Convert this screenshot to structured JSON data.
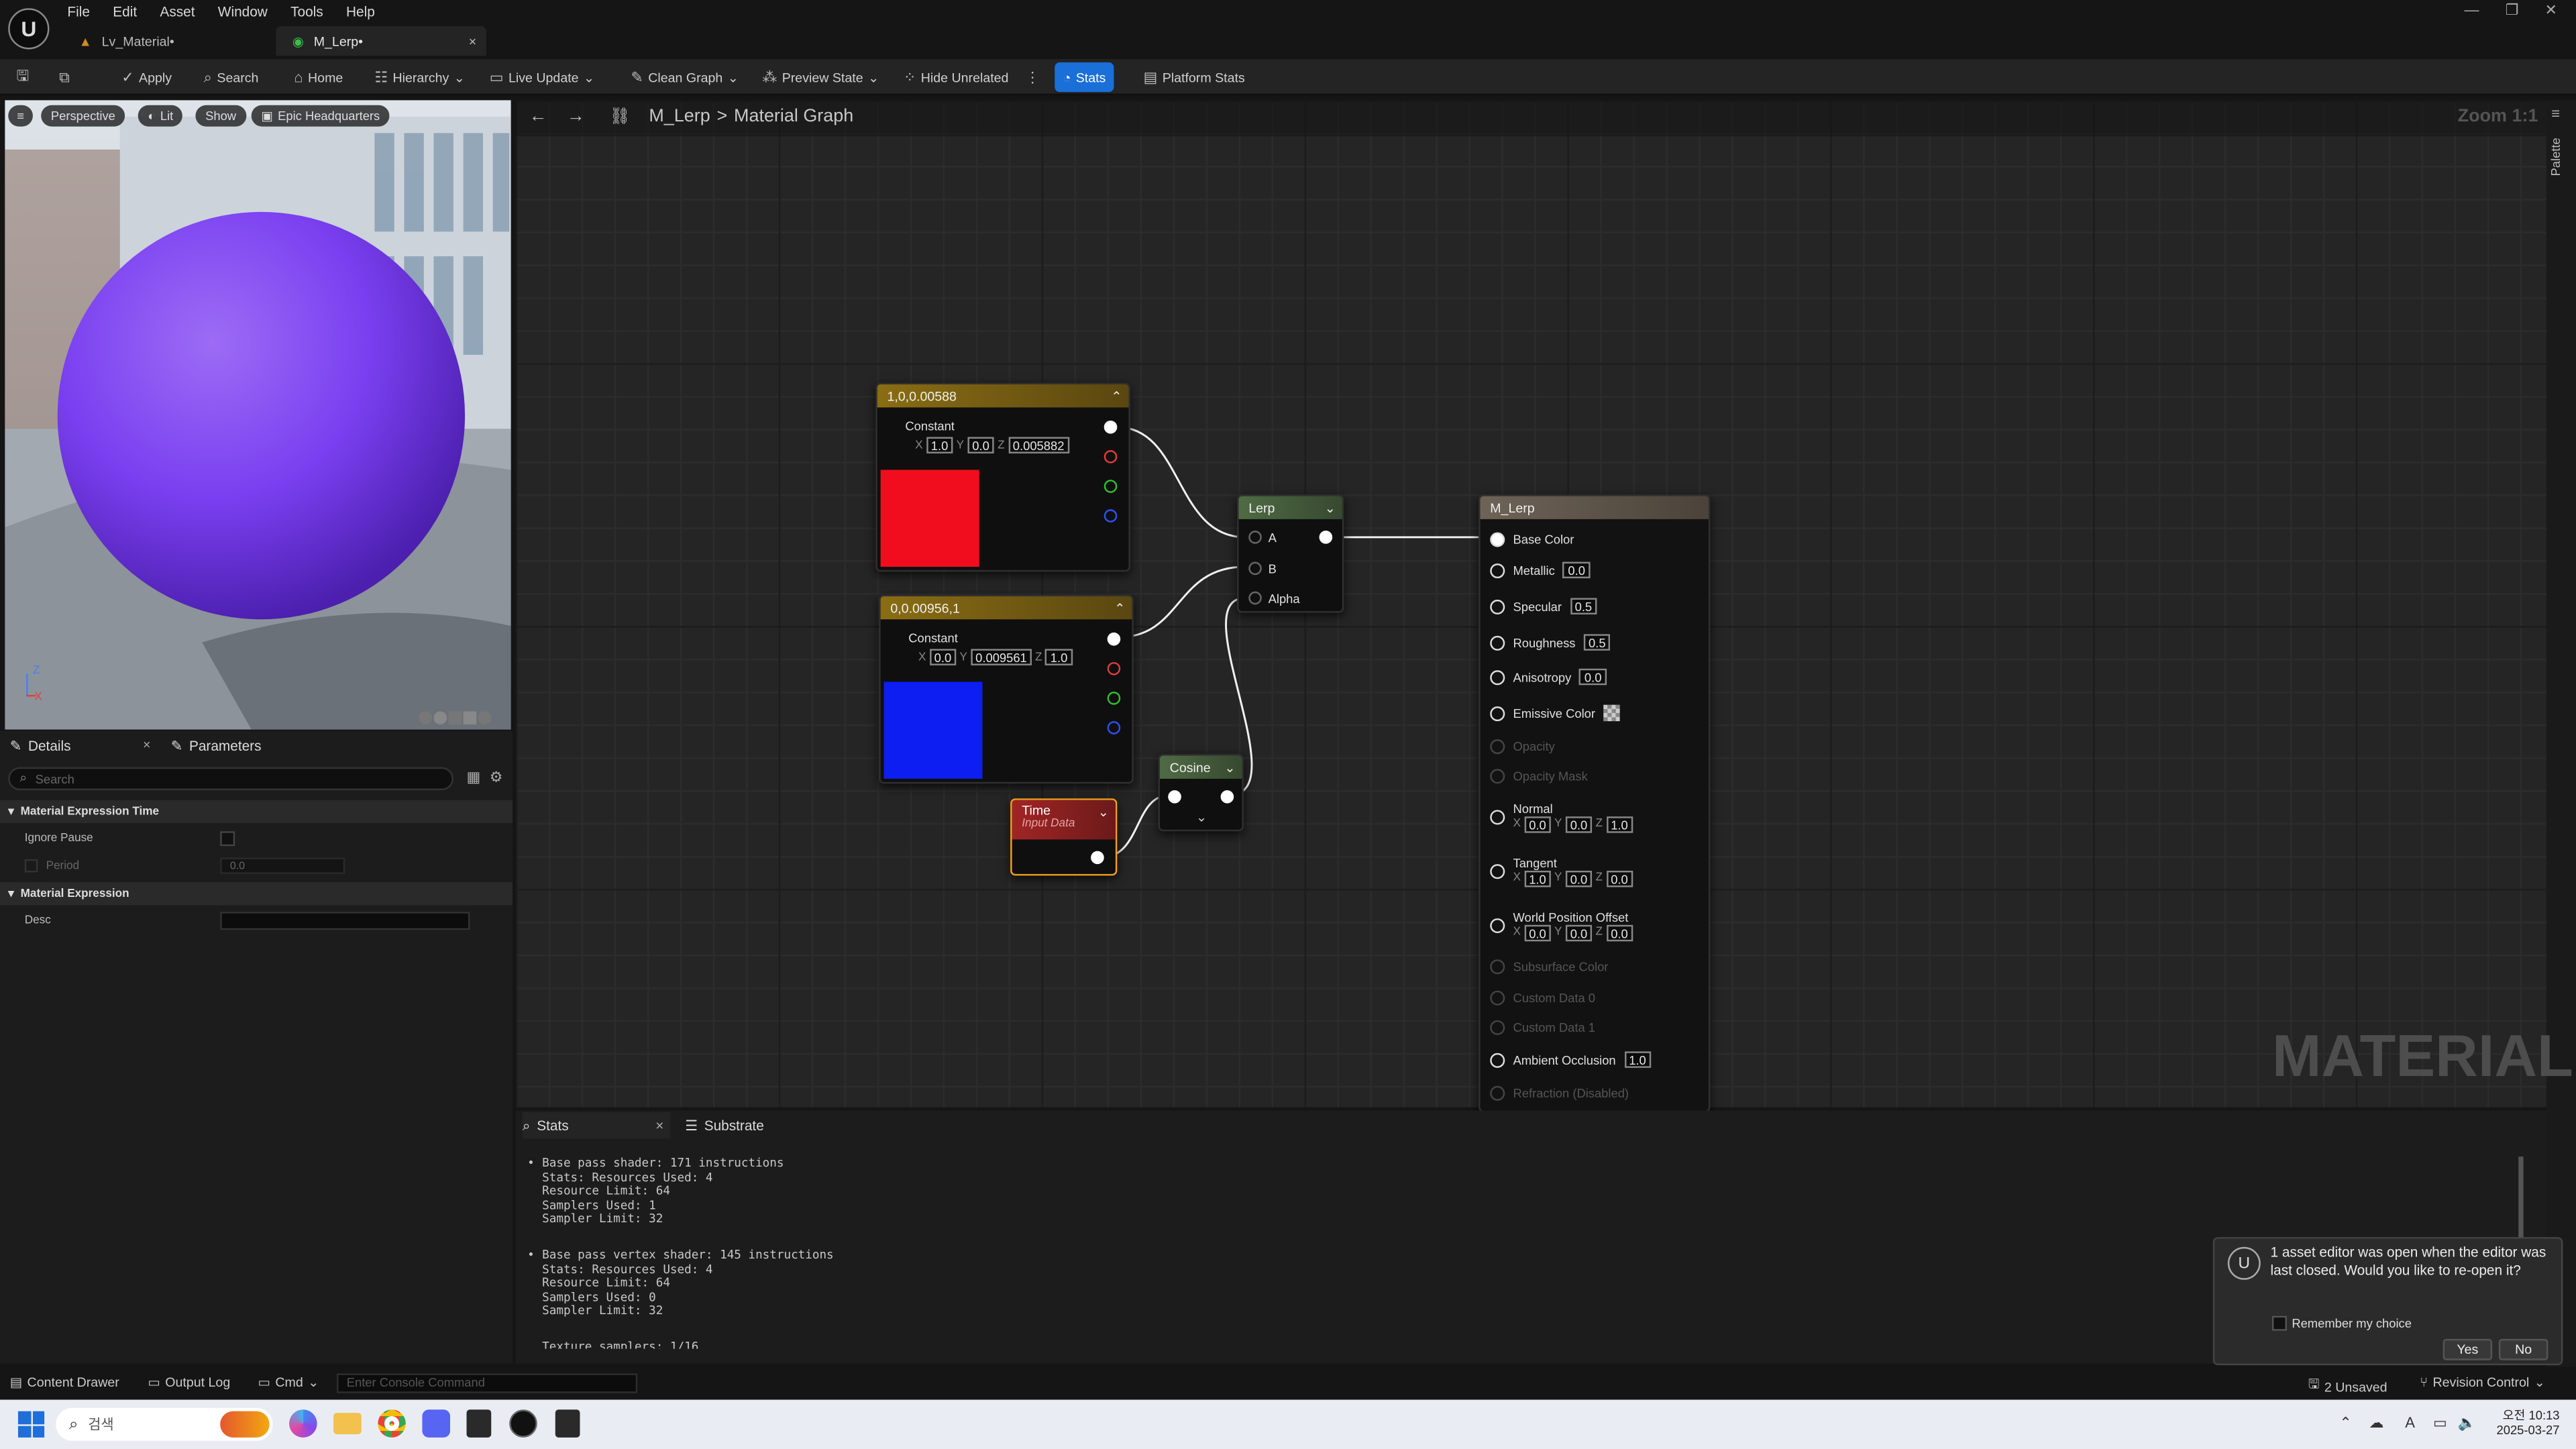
{
  "window": {
    "menu": [
      "File",
      "Edit",
      "Asset",
      "Window",
      "Tools",
      "Help"
    ],
    "tabs": [
      {
        "label": "Lv_Material•"
      },
      {
        "label": "M_Lerp•"
      }
    ]
  },
  "toolbar": {
    "apply": "Apply",
    "search": "Search",
    "home": "Home",
    "hierarchy": "Hierarchy",
    "live_update": "Live Update",
    "clean_graph": "Clean Graph",
    "preview_state": "Preview State",
    "hide_unrelated": "Hide Unrelated",
    "stats": "Stats",
    "platform_stats": "Platform Stats"
  },
  "viewport": {
    "perspective": "Perspective",
    "lit": "Lit",
    "show": "Show",
    "epic": "Epic Headquarters",
    "axis_z": "Z",
    "axis_x": "X"
  },
  "details": {
    "tab_details": "Details",
    "tab_parameters": "Parameters",
    "search_placeholder": "Search",
    "cat_time": "Material Expression Time",
    "ignore_pause": "Ignore Pause",
    "period": "Period",
    "period_value": "0.0",
    "cat_expr": "Material Expression",
    "desc": "Desc"
  },
  "graph": {
    "breadcrumb_asset": "M_Lerp",
    "breadcrumb_sep": ">",
    "breadcrumb_graph": "Material Graph",
    "zoom": "Zoom 1:1",
    "palette": "Palette",
    "watermark": "MATERIAL",
    "node_red": {
      "title": "1,0,0.00588",
      "type": "Constant",
      "x": "1.0",
      "y": "0.0",
      "z": "0.005882",
      "color": "#f20d1e"
    },
    "node_blue": {
      "title": "0,0.00956,1",
      "type": "Constant",
      "x": "0.0",
      "y": "0.009561",
      "z": "1.0",
      "color": "#0d1ef2"
    },
    "node_lerp": {
      "title": "Lerp",
      "a": "A",
      "b": "B",
      "alpha": "Alpha"
    },
    "node_cosine": {
      "title": "Cosine"
    },
    "node_time": {
      "title": "Time",
      "subtitle": "Input Data"
    },
    "node_material": {
      "title": "M_Lerp",
      "base_color": "Base Color",
      "metallic": "Metallic",
      "metallic_v": "0.0",
      "specular": "Specular",
      "specular_v": "0.5",
      "roughness": "Roughness",
      "roughness_v": "0.5",
      "anisotropy": "Anisotropy",
      "anisotropy_v": "0.0",
      "emissive": "Emissive Color",
      "opacity": "Opacity",
      "opacity_mask": "Opacity Mask",
      "normal": "Normal",
      "normal_x": "0.0",
      "normal_y": "0.0",
      "normal_z": "1.0",
      "tangent": "Tangent",
      "tangent_x": "1.0",
      "tangent_y": "0.0",
      "tangent_z": "0.0",
      "wpo": "World Position Offset",
      "wpo_x": "0.0",
      "wpo_y": "0.0",
      "wpo_z": "0.0",
      "subsurface": "Subsurface Color",
      "cd0": "Custom Data 0",
      "cd1": "Custom Data 1",
      "ao": "Ambient Occlusion",
      "ao_v": "1.0",
      "refraction": "Refraction (Disabled)"
    }
  },
  "stats": {
    "tab_stats": "Stats",
    "tab_substrate": "Substrate",
    "block1": [
      "Base pass shader: 171 instructions",
      "Stats: Resources Used: 4",
      "Resource Limit: 64",
      "Samplers Used: 1",
      "Sampler Limit: 32"
    ],
    "block2": [
      "Base pass vertex shader: 145 instructions",
      "Stats: Resources Used: 4",
      "Resource Limit: 64",
      "Samplers Used: 0",
      "Sampler Limit: 32"
    ],
    "block3": "Texture samplers: 1/16"
  },
  "statusbar": {
    "content_drawer": "Content Drawer",
    "output_log": "Output Log",
    "cmd": "Cmd",
    "console_placeholder": "Enter Console Command",
    "unsaved": "2 Unsaved",
    "revision": "Revision Control"
  },
  "notification": {
    "message": "1 asset editor was open when the editor was last closed. Would you like to re-open it?",
    "remember": "Remember my choice",
    "yes": "Yes",
    "no": "No"
  },
  "taskbar": {
    "search_placeholder": "검색",
    "time": "오전 10:13",
    "date": "2025-03-27",
    "ime": "A"
  }
}
